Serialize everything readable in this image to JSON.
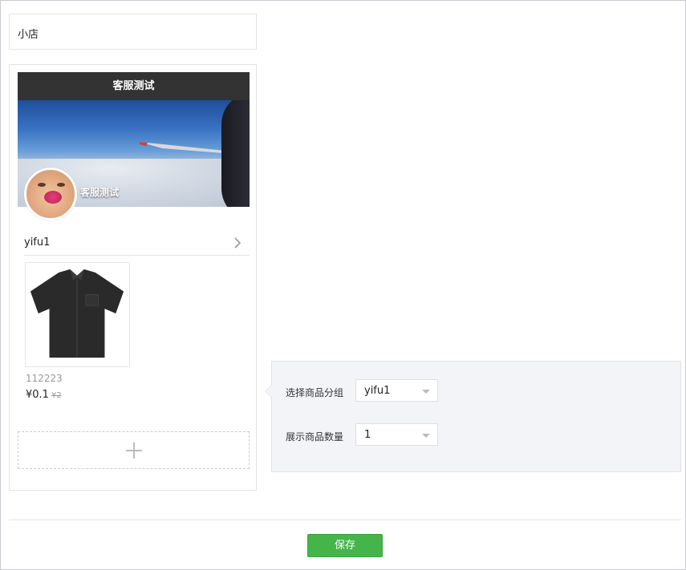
{
  "shop": {
    "title": "小店"
  },
  "preview": {
    "header_title": "客服测试",
    "shop_name": "客服测试",
    "group_name": "yifu1",
    "product": {
      "code": "112223",
      "price": "¥0.1",
      "old_price": "¥2"
    }
  },
  "settings": {
    "group_label": "选择商品分组",
    "group_value": "yifu1",
    "count_label": "展示商品数量",
    "count_value": "1"
  },
  "footer": {
    "save_label": "保存"
  },
  "colors": {
    "accent_green": "#44b549",
    "header_dark": "#333333"
  }
}
